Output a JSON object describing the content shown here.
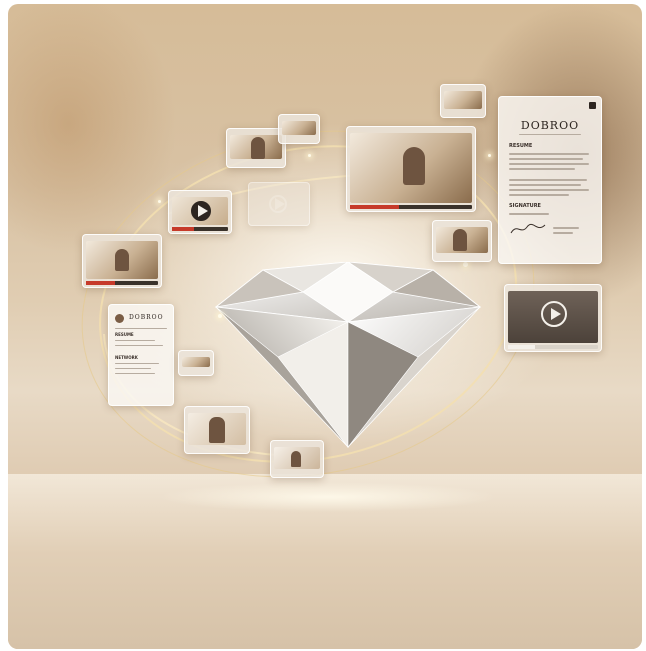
{
  "image": {
    "subject": "diamond-with-floating-media-cards",
    "colors": {
      "background": "#d8c2a4",
      "gold_accent": "#e6c98a",
      "diamond_light": "#f7f7f7",
      "video_progress": "#c63a2a"
    }
  },
  "resume_card_large": {
    "brand": "DOBROO",
    "section_resume": "RESUME",
    "section_signature": "SIGNATURE"
  },
  "resume_card_small": {
    "brand": "DOBROO",
    "section_1": "RESUME",
    "section_2": "NETWORK"
  },
  "icons": {
    "play": "play-icon"
  }
}
